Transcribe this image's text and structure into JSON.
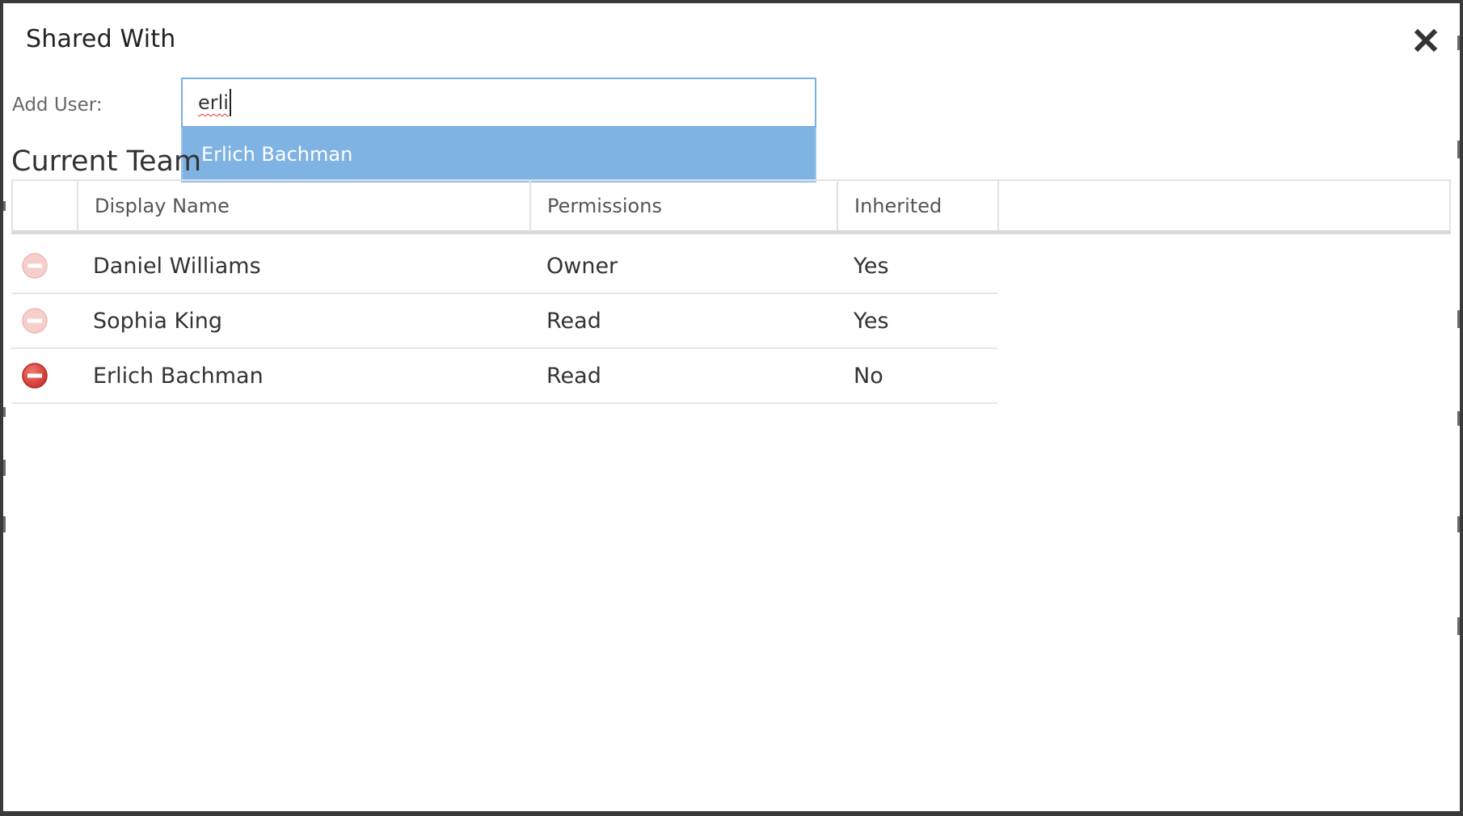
{
  "dialog": {
    "title": "Shared With",
    "close_icon": "close-icon"
  },
  "add_user": {
    "label": "Add User:",
    "value": "erli",
    "suggestion": "Erlich Bachman"
  },
  "team": {
    "heading": "Current Team",
    "columns": [
      "",
      "Display Name",
      "Permissions",
      "Inherited",
      ""
    ],
    "rows": [
      {
        "name": "Daniel Williams",
        "permission": "Owner",
        "inherited": "Yes",
        "remove_enabled": false
      },
      {
        "name": "Sophia King",
        "permission": "Read",
        "inherited": "Yes",
        "remove_enabled": false
      },
      {
        "name": "Erlich Bachman",
        "permission": "Read",
        "inherited": "No",
        "remove_enabled": true
      }
    ]
  },
  "colors": {
    "accent_border": "#7bb0e6",
    "suggestion_bg": "#7fb3e3",
    "remove_active": "#d9433a",
    "remove_disabled": "#f4c2bf"
  }
}
